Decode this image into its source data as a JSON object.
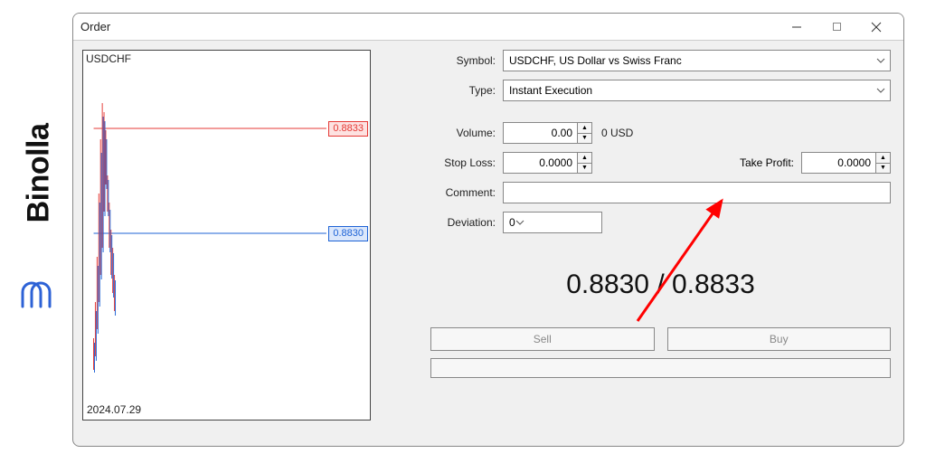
{
  "brand": {
    "name": "Binolla"
  },
  "window": {
    "title": "Order"
  },
  "chart": {
    "symbol": "USDCHF",
    "date": "2024.07.29",
    "ask": "0.8833",
    "bid": "0.8830"
  },
  "form": {
    "symbol_label": "Symbol:",
    "symbol_value": "USDCHF, US Dollar vs Swiss Franc",
    "type_label": "Type:",
    "type_value": "Instant Execution",
    "volume_label": "Volume:",
    "volume_value": "0.00",
    "volume_usd": "0 USD",
    "stop_loss_label": "Stop Loss:",
    "stop_loss_value": "0.0000",
    "take_profit_label": "Take Profit:",
    "take_profit_value": "0.0000",
    "comment_label": "Comment:",
    "comment_value": "",
    "deviation_label": "Deviation:",
    "deviation_value": "0"
  },
  "quote": "0.8830 / 0.8833",
  "buttons": {
    "sell": "Sell",
    "buy": "Buy"
  },
  "chart_data": {
    "type": "line",
    "symbol": "USDCHF",
    "bid_line": 0.883,
    "ask_line": 0.8833,
    "date_axis": "2024.07.29"
  }
}
